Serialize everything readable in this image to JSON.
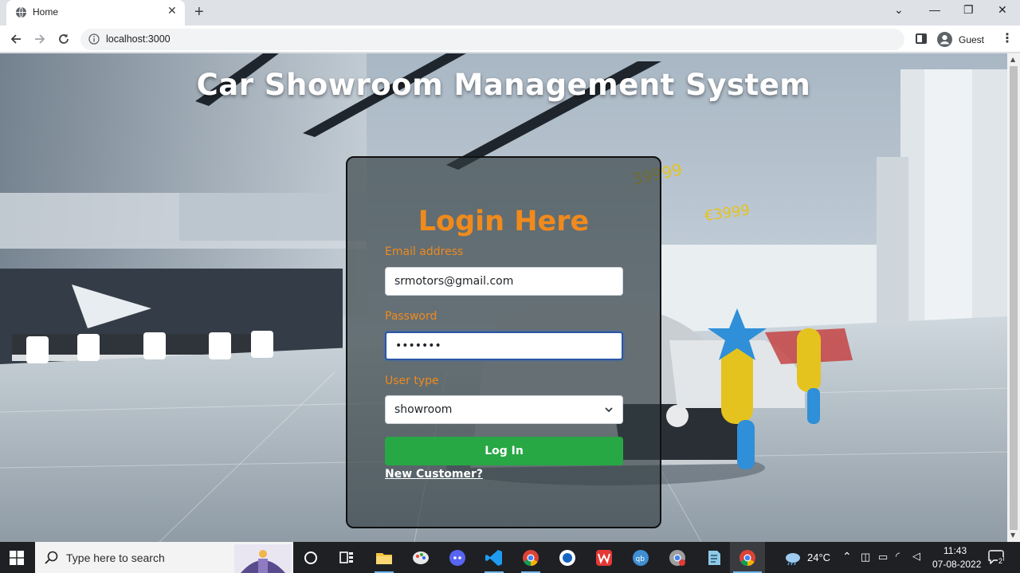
{
  "browser": {
    "tab_title": "Home",
    "tab_close": "✕",
    "new_tab": "+",
    "url": "localhost:3000",
    "profile_name": "Guest",
    "menu": "⋮",
    "window_controls": [
      "⌄",
      "—",
      "❐",
      "✕"
    ]
  },
  "page": {
    "app_title": "Car Showroom Management System",
    "login": {
      "heading": "Login Here",
      "email_label": "Email address",
      "email_value": "srmotors@gmail.com",
      "password_label": "Password",
      "password_value": "•••••••",
      "usertype_label": "User type",
      "usertype_selected": "showroom",
      "login_button": "Log In",
      "new_customer_link": "New Customer?"
    }
  },
  "taskbar": {
    "search_placeholder": "Type here to search",
    "weather_temp": "24°C",
    "time": "11:43",
    "date": "07-08-2022",
    "notification_count": "2",
    "pinned_icons": [
      "cortana-icon",
      "task-view-icon",
      "file-explorer-icon",
      "paint-icon",
      "discord-icon",
      "vscode-icon",
      "chrome-icon",
      "app-icon",
      "wps-icon",
      "qbittorrent-icon",
      "chrome-canary-icon",
      "notepad-icon",
      "chrome-active-icon"
    ]
  },
  "colors": {
    "accent_orange": "#f08a1c",
    "login_green": "#28a745",
    "card_overlay": "rgba(50,62,66,0.66)"
  }
}
